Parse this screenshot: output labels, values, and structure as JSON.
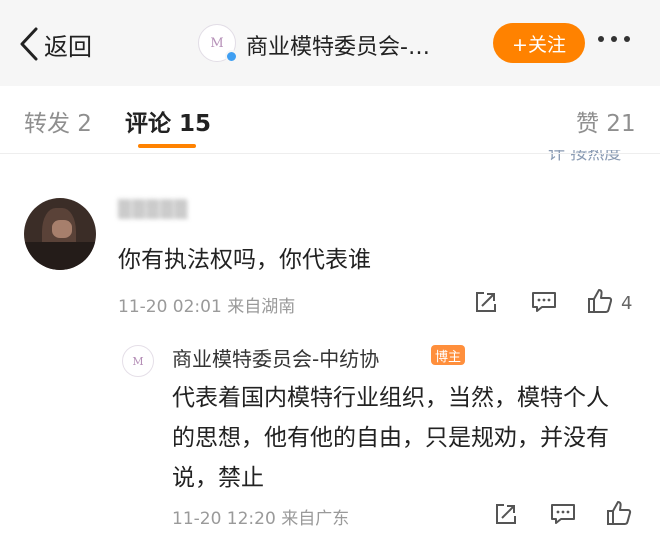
{
  "header": {
    "back_label": "返回",
    "title": "商业模特委员会-…",
    "logo_letter": "M",
    "follow_label": "+关注"
  },
  "tabs": {
    "repost": "转发 2",
    "comments": "评论 15",
    "likes": "赞 21",
    "sort_partial": "计 按热度"
  },
  "comment": {
    "username": "▒▒▒▒▒",
    "text": "你有执法权吗，你代表谁",
    "meta": "11-20 02:01  来自湖南",
    "like_count": "4"
  },
  "reply": {
    "author": "商业模特委员会-中纺协",
    "badge": "博主",
    "logo_letter": "M",
    "text": "代表着国内模特行业组织，当然，模特个人的思想，他有他的自由，只是规劝，并没有说，禁止",
    "meta": "11-20 12:20  来自广东",
    "like_count": ""
  },
  "colors": {
    "accent": "#ff8200",
    "verify_blue": "#3f9ff2",
    "badge": "#ff8f3c",
    "muted": "#9a9a9a"
  },
  "icons": [
    "chevron-left-icon",
    "more-dots-icon",
    "share-icon",
    "comment-icon",
    "thumbs-up-icon",
    "verified-icon"
  ]
}
